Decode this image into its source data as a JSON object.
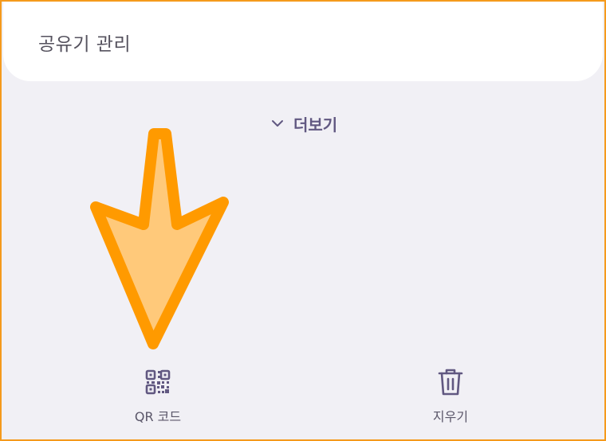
{
  "card": {
    "title": "공유기 관리"
  },
  "more": {
    "label": "더보기",
    "icon": "chevron-down-icon"
  },
  "actions": {
    "qr": {
      "label": "QR 코드",
      "icon": "qr-code-icon"
    },
    "delete": {
      "label": "지우기",
      "icon": "trash-icon"
    }
  },
  "colors": {
    "background": "#f1f0f5",
    "card": "#ffffff",
    "accent": "#615881",
    "frame": "#f59a1c",
    "annotation_fill": "#ffc97a",
    "annotation_stroke": "#ff9a00"
  }
}
